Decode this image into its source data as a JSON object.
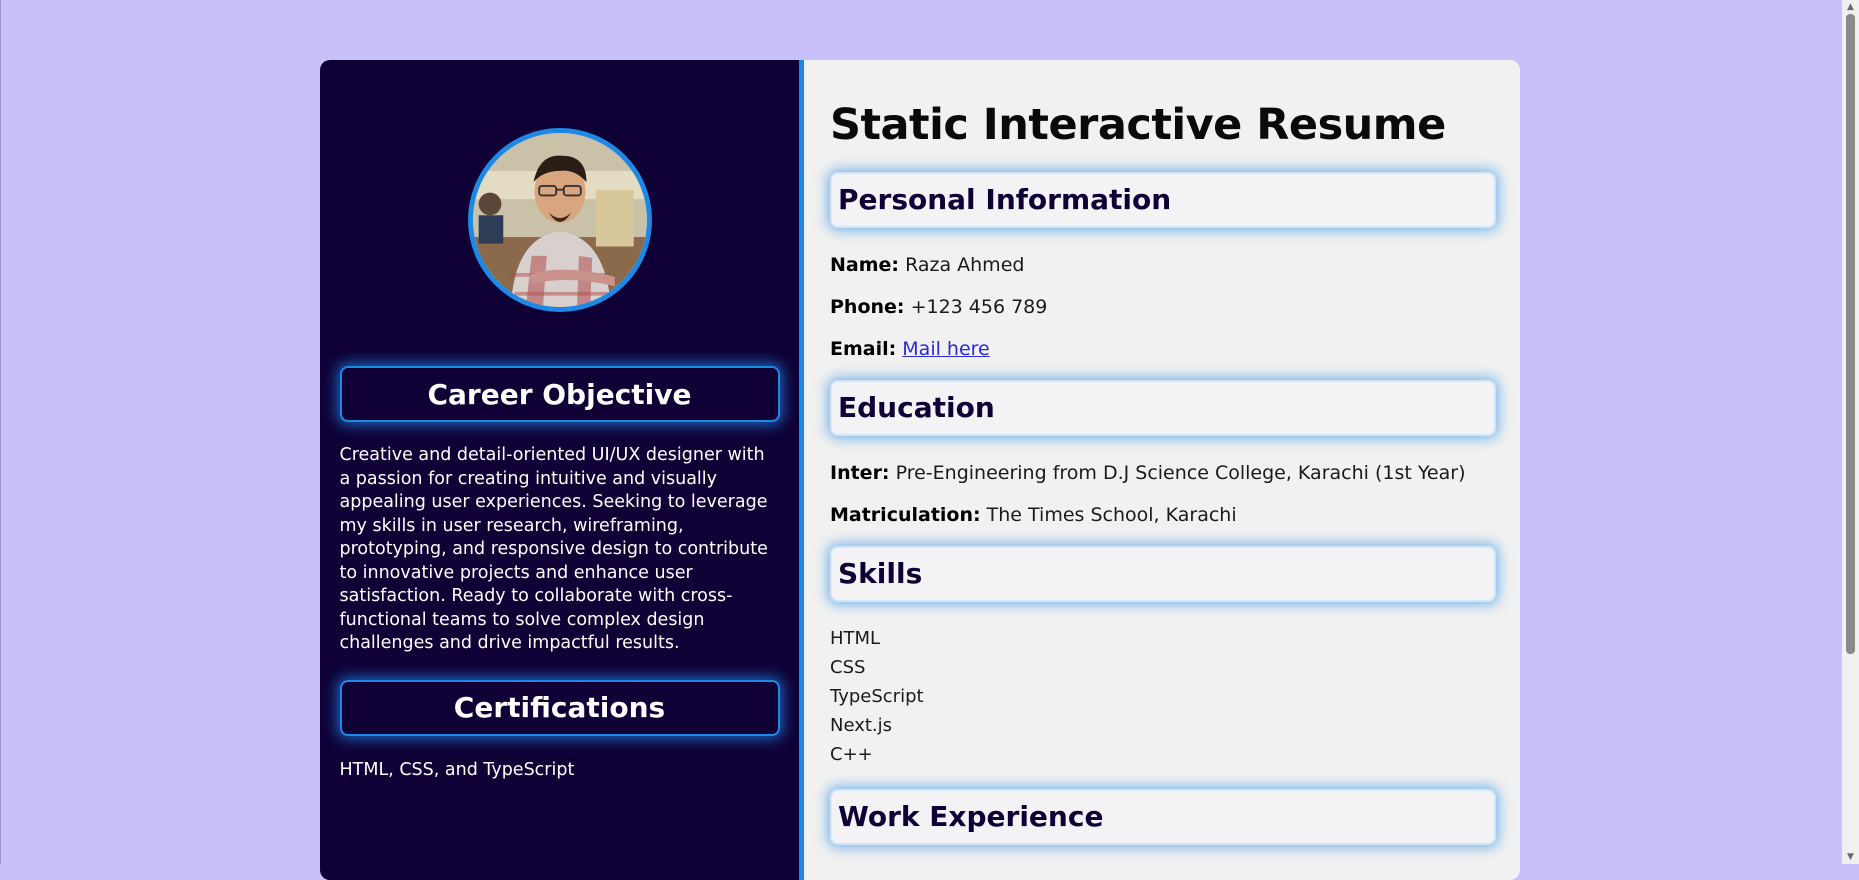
{
  "sidebar": {
    "career_heading": "Career Objective",
    "objective": "Creative and detail-oriented UI/UX designer with a passion for creating intuitive and visually appealing user experiences. Seeking to leverage my skills in user research, wireframing, prototyping, and responsive design to contribute to innovative projects and enhance user satisfaction. Ready to collaborate with cross-functional teams to solve complex design challenges and drive impactful results.",
    "cert_heading": "Certifications",
    "cert_text": "HTML, CSS, and TypeScript"
  },
  "main": {
    "title": "Static Interactive Resume",
    "personal_heading": "Personal Information",
    "name_label": "Name:",
    "name_value": "Raza Ahmed",
    "phone_label": "Phone:",
    "phone_value": "+123 456 789",
    "email_label": "Email:",
    "email_link": "Mail here",
    "education_heading": "Education",
    "inter_label": "Inter:",
    "inter_value": "Pre-Engineering from D.J Science College, Karachi (1st Year)",
    "matric_label": "Matriculation:",
    "matric_value": "The Times School, Karachi",
    "skills_heading": "Skills",
    "skills": [
      "HTML",
      "CSS",
      "TypeScript",
      "Next.js",
      "C++"
    ],
    "work_heading": "Work Experience"
  },
  "colors": {
    "page_bg": "#c8c0f8",
    "sidebar_bg": "#0f0036",
    "accent": "#1e88e5",
    "main_bg": "#f1f1f1"
  },
  "icons": [
    "profile-photo",
    "scroll-up-arrow-icon",
    "scroll-down-arrow-icon"
  ]
}
